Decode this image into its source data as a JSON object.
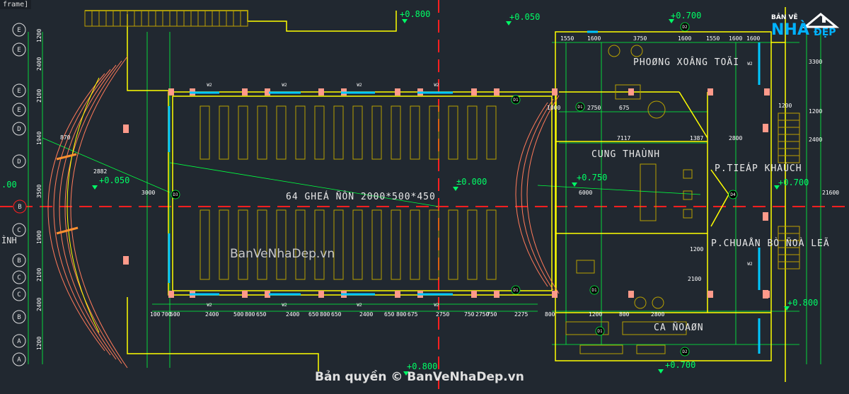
{
  "viewport_label": "frame]",
  "rooms": {
    "phong_xong_toai": "PHOØNG XOÂNG TOÄI",
    "cung_thanh": "CUNG THAÙNH",
    "tiep_khach": "P.TIEÁP KHAÙCH",
    "chuan_bi_nghi_le": "P.CHUAÅN BÒ ÑOÀ LEÃ",
    "ca_doan": "CA ÑOAØN"
  },
  "seating_note": "64 GHEÁ ÑÔN 2000*500*450",
  "watermark": "BanVeNhaDep.vn",
  "copyright": "Bản quyền © BanVeNhaDep.vn",
  "logo": {
    "top": "BẢN VẼ",
    "nha": "NHÀ",
    "dep": "ĐẸP"
  },
  "levels": {
    "top_mid": "+0.800",
    "top_right_a": "+0.050",
    "top_right_b": "+0.700",
    "left": "+0.050",
    "center": "±0.000",
    "right": "+0.750",
    "far_right": "+0.700",
    "bottom_right": "+0.800",
    "bottom_mid": "+0.800",
    "bottom_right_b": "+0.700",
    "edge": ".00"
  },
  "axes_left": [
    "E",
    "E",
    "E",
    "E",
    "D",
    "D",
    "C",
    "B",
    "C",
    "C",
    "B",
    "A",
    "A"
  ],
  "axis_center": "B",
  "left_fragment": "ÌNH",
  "doors": [
    "D1",
    "D1",
    "D1",
    "D1",
    "D1",
    "D2",
    "D2",
    "D3",
    "D4"
  ],
  "windows": [
    "W2",
    "W2",
    "W2",
    "W2",
    "W2",
    "W2",
    "W2",
    "W2",
    "W2",
    "W2"
  ],
  "dims_bottom": [
    "100",
    "700",
    "500",
    "2400",
    "500",
    "800",
    "650",
    "2400",
    "650",
    "800",
    "650",
    "2400",
    "650",
    "800",
    "675",
    "2750",
    "750",
    "2750",
    "750",
    "2275",
    "800",
    "1200",
    "800",
    "2800"
  ],
  "dims_left": [
    "1200",
    "2400",
    "2100",
    "1940",
    "3500",
    "1900",
    "2100",
    "2400",
    "1200"
  ],
  "dims_misc": [
    "1550",
    "1600",
    "3750",
    "1600",
    "1550",
    "1600",
    "1600",
    "1000",
    "2750",
    "675",
    "7117",
    "1387",
    "2800",
    "2882",
    "870",
    "1200",
    "2100",
    "1200",
    "21600",
    "3300",
    "1200",
    "2400",
    "3000",
    "6000"
  ],
  "colors": {
    "background": "#212830",
    "wall": "#ffff00",
    "grid": "#ff2020",
    "dimension": "#00ff40",
    "furniture": "#b8a000",
    "column": "#ff9a8a",
    "window": "#00c8ff"
  }
}
